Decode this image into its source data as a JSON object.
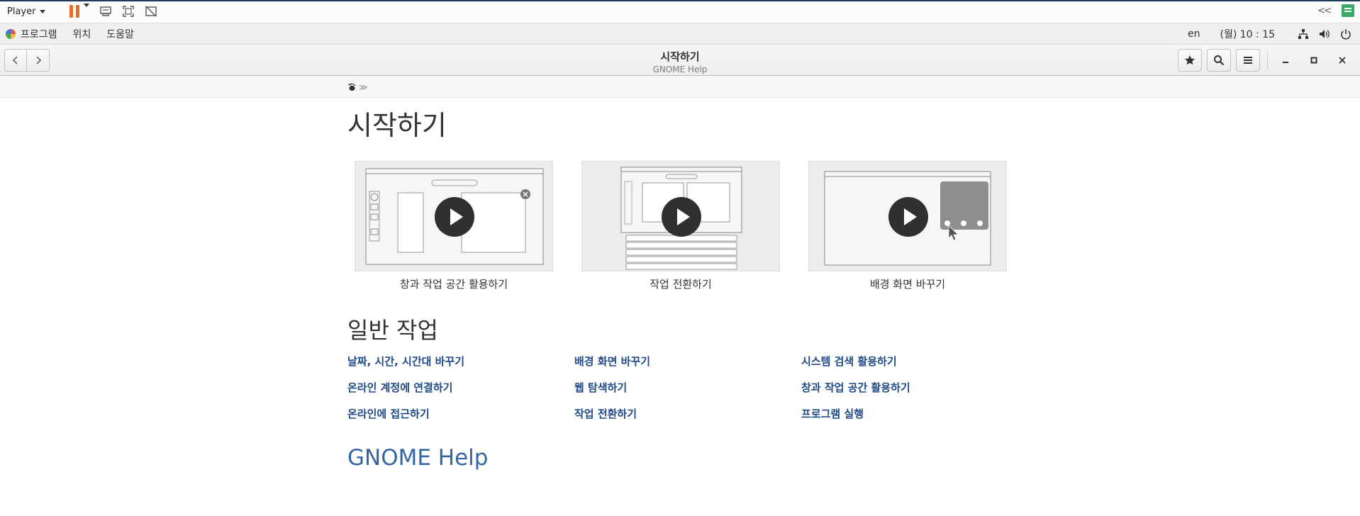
{
  "player_bar": {
    "menu_label": "Player",
    "icons": [
      "pause-icon",
      "send-keys-icon",
      "fit-window-icon",
      "unity-icon",
      "collapse-icon",
      "notes-icon"
    ],
    "collapse_label": "<<",
    "pause_color": "#e07028"
  },
  "gnome_bar": {
    "apps_label": "프로그램",
    "places_label": "위치",
    "help_label": "도움말",
    "language": "en",
    "clock": "(월) 10 : 15",
    "status_icons": [
      "network-icon",
      "volume-icon",
      "power-icon"
    ]
  },
  "headerbar": {
    "title": "시작하기",
    "subtitle": "GNOME Help",
    "buttons": [
      "back-button",
      "forward-button",
      "bookmark-button",
      "search-button",
      "menu-button",
      "minimize-button",
      "maximize-button",
      "close-button"
    ]
  },
  "breadcrumb": {
    "separator": "≫"
  },
  "page": {
    "title": "시작하기",
    "videos": [
      {
        "label": "창과 작업 공간 활용하기"
      },
      {
        "label": "작업 전환하기"
      },
      {
        "label": "배경 화면 바꾸기"
      }
    ],
    "section_title": "일반 작업",
    "links": [
      "날짜, 시간, 시간대 바꾸기",
      "배경 화면 바꾸기",
      "시스템 검색 활용하기",
      "온라인 계정에 연결하기",
      "웹 탐색하기",
      "창과 작업 공간 활용하기",
      "온라인에 접근하기",
      "작업 전환하기",
      "프로그램 실행"
    ],
    "footer_link": "GNOME Help",
    "link_color": "#204a87"
  }
}
